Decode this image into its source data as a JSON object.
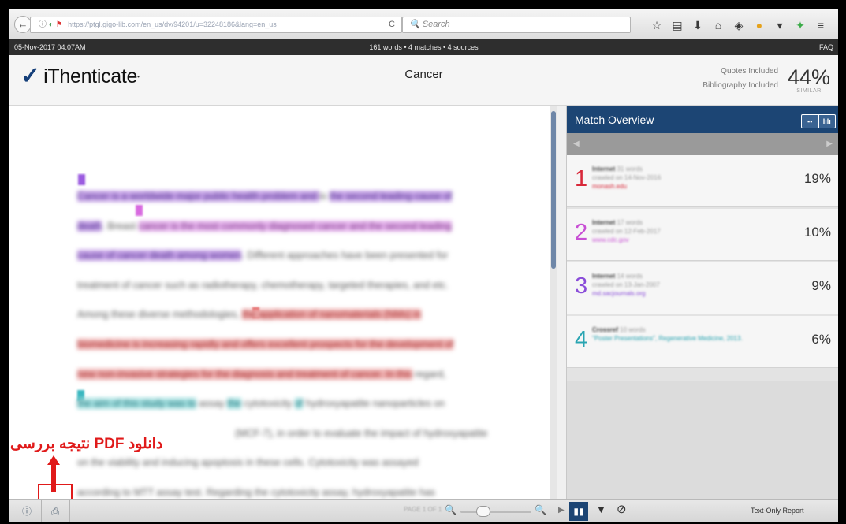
{
  "browser": {
    "url_text": "https://ptgl.gigo-lib.com/en_us/dv/94201/u=32248186&lang=en_us",
    "url_domain": "gigo-lib.com",
    "search_placeholder": "Search",
    "icons": [
      "bookmark-star-icon",
      "reading-list-icon",
      "download-icon",
      "home-icon",
      "pocket-icon",
      "extension-icon",
      "menu-dropdown-icon",
      "tools-icon",
      "hamburger-menu-icon"
    ]
  },
  "info_strip": {
    "date": "05-Nov-2017 04:07AM",
    "summary": "161 words • 4 matches • 4 sources",
    "faq": "FAQ"
  },
  "header": {
    "logo_text": "iThenticate",
    "title": "Cancer",
    "quotes": "Quotes Included",
    "bibliography": "Bibliography Included",
    "similarity": "44%",
    "similarity_label": "SIMILAR"
  },
  "document": {
    "colors": {
      "purple": "#c9a5ea",
      "pink": "#e8b5ef",
      "red": "#f0b2b2",
      "teal": "#a6e2e2"
    },
    "lines": [
      {
        "segs": [
          {
            "t": "Cancer is a worldwide ",
            "c": "purple"
          },
          {
            "t": "major public health problem and ",
            "c": "purple"
          },
          {
            "t": "is ",
            "c": ""
          },
          {
            "t": "the second leading cause of",
            "c": "purple"
          }
        ]
      },
      {
        "segs": [
          {
            "t": "death",
            "c": "purple"
          },
          {
            "t": ". Breast ",
            "c": ""
          },
          {
            "t": "cancer is the most commonly diagnosed cancer and the second leading",
            "c": "pink"
          }
        ]
      },
      {
        "segs": [
          {
            "t": "cause of cancer death among women",
            "c": "purple"
          },
          {
            "t": ". Different approaches have been presented for",
            "c": ""
          }
        ]
      },
      {
        "segs": [
          {
            "t": "treatment of cancer such as radiotherapy, chemotherapy, targeted therapies, and etc.",
            "c": ""
          }
        ]
      },
      {
        "segs": [
          {
            "t": "Among these diverse methodologies, ",
            "c": ""
          },
          {
            "t": "the application of nanomaterials (NMs) in",
            "c": "red"
          }
        ]
      },
      {
        "segs": [
          {
            "t": "biomedicine is increasing rapidly and offers excellent prospects for the development of",
            "c": "red"
          }
        ]
      },
      {
        "segs": [
          {
            "t": "new non-invasive strategies for the diagnosis and treatment of cancer. In this",
            "c": "red"
          },
          {
            "t": " regard,",
            "c": ""
          }
        ]
      },
      {
        "segs": [
          {
            "t": "the aim of this study was to",
            "c": "teal"
          },
          {
            "t": " assay ",
            "c": ""
          },
          {
            "t": "the",
            "c": "teal"
          },
          {
            "t": " cytotoxicity ",
            "c": ""
          },
          {
            "t": "of",
            "c": "teal"
          },
          {
            "t": " hydroxyapatite nanoparticles on",
            "c": ""
          }
        ]
      },
      {
        "segs": [
          {
            "t": "(MCF-7), in order to evaluate the impact of hydroxyapatite",
            "c": ""
          }
        ]
      },
      {
        "segs": [
          {
            "t": "on the viability and inducing apoptosis in these cells. Cytotoxicity was assayed",
            "c": ""
          }
        ]
      },
      {
        "segs": [
          {
            "t": "according to MTT assay test. Regarding the cytotoxicity assay, hydroxyapatite has",
            "c": ""
          }
        ]
      }
    ]
  },
  "annotation": {
    "text": "دانلود PDF نتیجه بررسی"
  },
  "panel": {
    "title": "Match Overview",
    "toggle_left": "▪▪",
    "toggle_right": "lılı",
    "nav_left": "◀",
    "nav_right": "▶",
    "matches": [
      {
        "num": "1",
        "source_type": "Internet",
        "words": "31 words",
        "date": "crawled on 14-Nov-2016",
        "site": "monash.edu",
        "pct": "19%",
        "color": "#d8293a"
      },
      {
        "num": "2",
        "source_type": "Internet",
        "words": "17 words",
        "date": "crawled on 12-Feb-2017",
        "site": "www.cdc.gov",
        "pct": "10%",
        "color": "#c84fd4"
      },
      {
        "num": "3",
        "source_type": "Internet",
        "words": "14 words",
        "date": "crawled on 13-Jan-2007",
        "site": "md.sacjournals.org",
        "pct": "9%",
        "color": "#8a4dd9"
      },
      {
        "num": "4",
        "source_type": "Crossref",
        "words": "10 words",
        "date": "\"Poster Presentations\", Regenerative Medicine, 2013.",
        "site": "",
        "pct": "6%",
        "color": "#2aa5b2"
      }
    ]
  },
  "bottom_bar": {
    "pages": "PAGE 1 OF 1",
    "text_only": "Text-Only Report"
  }
}
